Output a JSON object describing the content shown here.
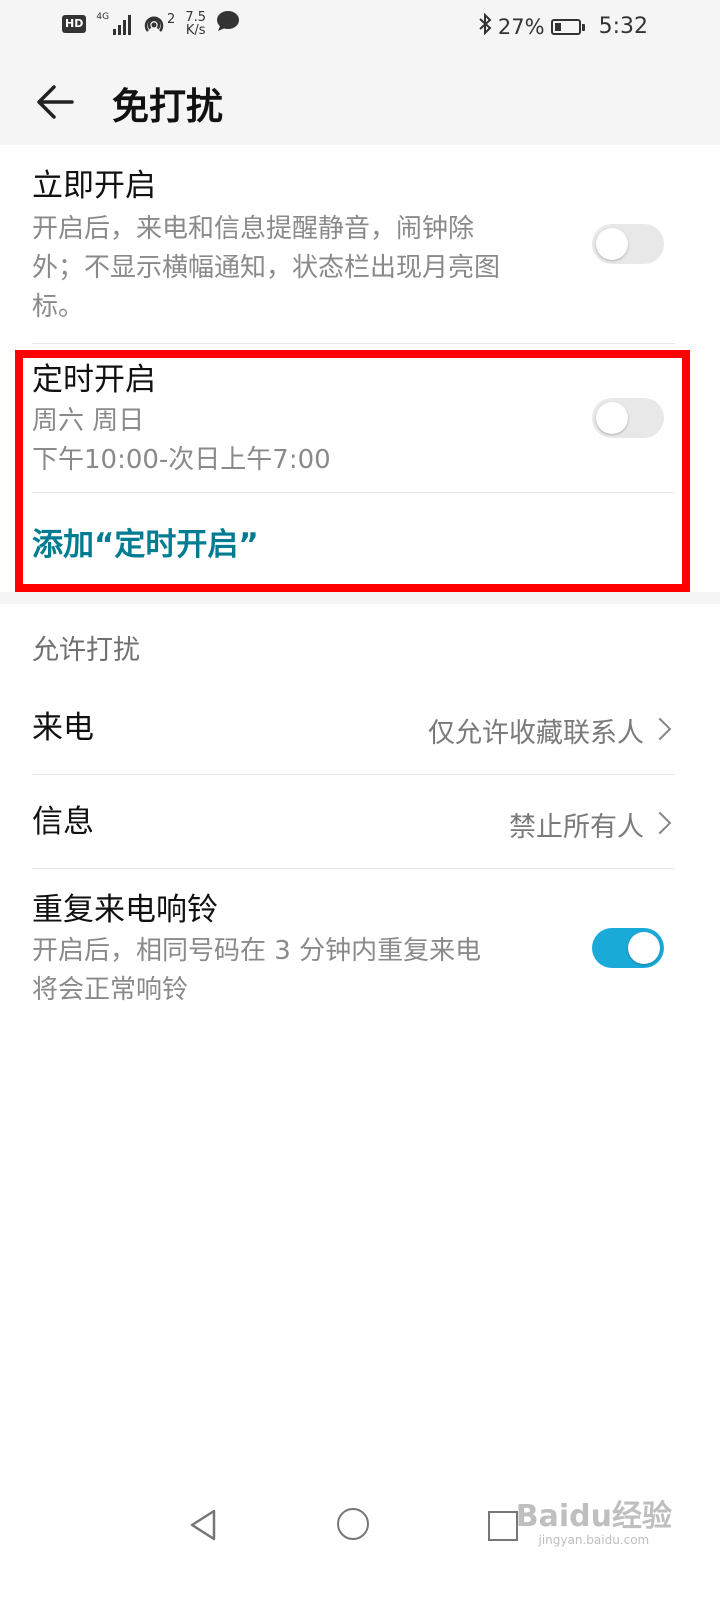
{
  "status_bar": {
    "hd": "HD",
    "network": "4G",
    "hotspot_count": "2",
    "speed_value": "7.5",
    "speed_unit": "K/s",
    "battery_percent": "27%",
    "battery_level": 0.27,
    "time": "5:32"
  },
  "header": {
    "title": "免打扰"
  },
  "immediate": {
    "title": "立即开启",
    "desc_line1": "开启后，来电和信息提醒静音，闹钟除",
    "desc_line2": "外；不显示横幅通知，状态栏出现月亮图",
    "desc_line3": "标。",
    "enabled": false
  },
  "scheduled": {
    "title": "定时开启",
    "days": "周六 周日",
    "time_range": "下午10:00-次日上午7:00",
    "enabled": false,
    "add_label": "添加“定时开启”"
  },
  "allow_section": {
    "header": "允许打扰",
    "calls": {
      "label": "来电",
      "value": "仅允许收藏联系人"
    },
    "messages": {
      "label": "信息",
      "value": "禁止所有人"
    },
    "repeat_calls": {
      "title": "重复来电响铃",
      "desc_line1": "开启后，相同号码在 3 分钟内重复来电",
      "desc_line2": "将会正常响铃",
      "enabled": true
    }
  },
  "watermark": {
    "main": "Baidu经验",
    "sub": "jingyan.baidu.com"
  },
  "colors": {
    "accent": "#1aaad8",
    "link": "#007c92",
    "highlight": "#ff0000"
  }
}
